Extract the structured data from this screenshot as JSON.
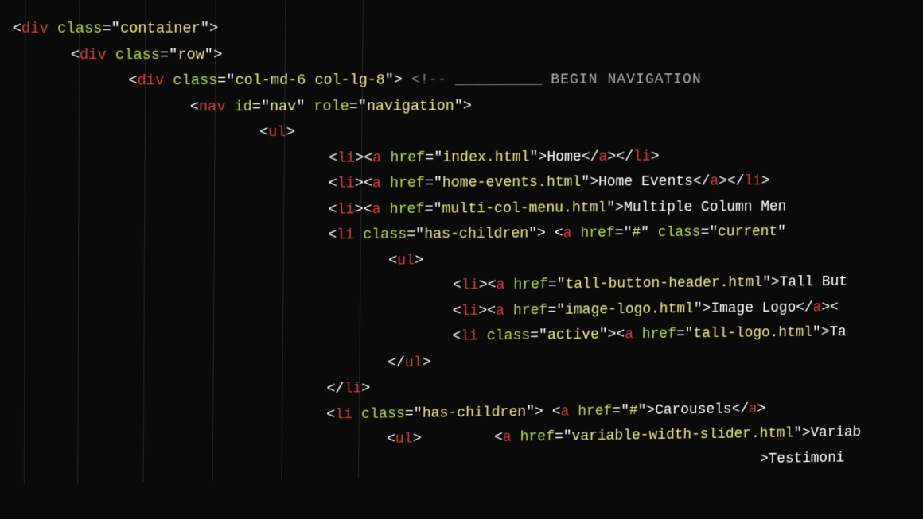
{
  "tags": {
    "div": "div",
    "nav": "nav",
    "ul": "ul",
    "li": "li",
    "a": "a"
  },
  "attrs": {
    "class": "class",
    "id": "id",
    "role": "role",
    "href": "href"
  },
  "values": {
    "container": "container",
    "row": "row",
    "colmd": "col-md-6 col-lg-8",
    "nav": "nav",
    "navigation": "navigation",
    "haschildren": "has-children",
    "current": "current",
    "active": "active",
    "hash": "#",
    "index": "index.html",
    "homeevents": "home-events.html",
    "multicol": "multi-col-menu.html",
    "tallbtn": "tall-button-header.html",
    "imglogo": "image-logo.html",
    "talllogo": "tall-logo.html",
    "varslider": "variable-width-slider.html"
  },
  "text": {
    "home": "Home",
    "homeevents": "Home Events",
    "multicol": "Multiple Column Men",
    "tallbut": "Tall But",
    "imagelogo": "Image Logo",
    "ta": "Ta",
    "carousels": "Carousels",
    "variab": "Variab",
    "testimoni": "Testimoni"
  },
  "comment": {
    "begin": "BEGIN NAVIGATION"
  },
  "punct": {
    "lt": "<",
    "gt": ">",
    "eq": "=",
    "q": "\"",
    "slash": "/",
    "cmtopen": "<!--",
    "under": "__________"
  }
}
